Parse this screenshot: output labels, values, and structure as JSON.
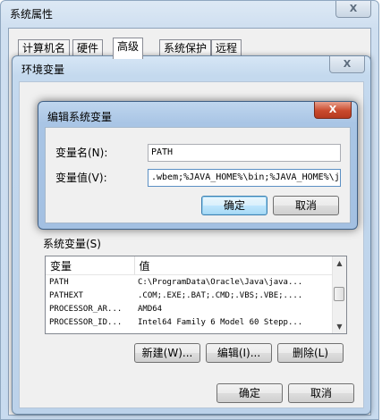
{
  "sys_props": {
    "title": "系统属性",
    "close_label": "X",
    "tabs": [
      "计算机名",
      "硬件",
      "高级",
      "系统保护",
      "远程"
    ],
    "ok_label": "确定",
    "cancel_label": "取消"
  },
  "env_vars": {
    "title": "环境变量",
    "close_label": "X",
    "behind_text": ".wbem;%JAVA_HOME%\\bin;%JAVA_HOME%\\jr",
    "sys_section_label": "系统变量(S)",
    "columns": [
      "变量",
      "值"
    ],
    "rows": [
      {
        "name": "PATH",
        "value": "C:\\ProgramData\\Oracle\\Java\\java..."
      },
      {
        "name": "PATHEXT",
        "value": ".COM;.EXE;.BAT;.CMD;.VBS;.VBE;...."
      },
      {
        "name": "PROCESSOR_AR...",
        "value": "AMD64"
      },
      {
        "name": "PROCESSOR_ID...",
        "value": "Intel64 Family 6 Model 60 Stepp..."
      }
    ],
    "new_label": "新建(W)...",
    "edit_label": "编辑(I)...",
    "delete_label": "删除(L)",
    "ok_label": "确定",
    "cancel_label": "取消"
  },
  "edit_dialog": {
    "title": "编辑系统变量",
    "close_label": "X",
    "name_label": "变量名(N):",
    "name_value": "PATH",
    "value_label": "变量值(V):",
    "value_value": ".wbem;%JAVA_HOME%\\bin;%JAVA_HOME%\\jr",
    "ok_label": "确定",
    "cancel_label": "取消"
  }
}
